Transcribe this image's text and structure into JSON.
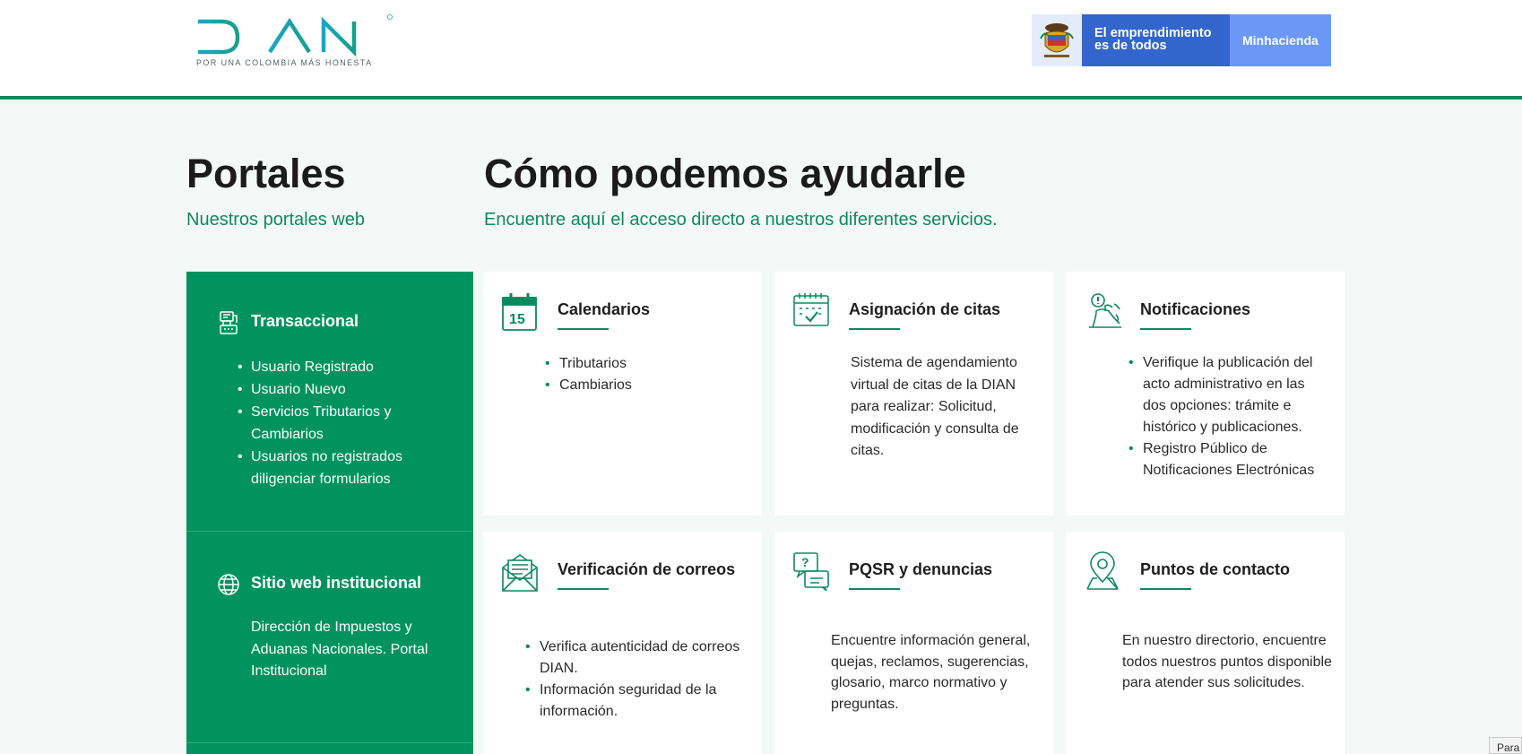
{
  "header": {
    "logo_text": "DIAN",
    "logo_tagline": "POR UNA COLOMBIA MÁS HONESTA",
    "gov_slogan_line1": "El emprendimiento",
    "gov_slogan_line2": "es de todos",
    "gov_ministry": "Minhacienda"
  },
  "portales": {
    "title": "Portales",
    "subtitle": "Nuestros portales web",
    "items": [
      {
        "title": "Transaccional",
        "bullets": [
          "Usuario Registrado",
          "Usuario Nuevo",
          "Servicios Tributarios y Cambiarios",
          "Usuarios no registrados diligenciar formularios"
        ]
      },
      {
        "title": "Sitio web institucional",
        "text": "Dirección de Impuestos y Aduanas Nacionales. Portal Institucional"
      }
    ]
  },
  "ayuda": {
    "title": "Cómo podemos ayudarle",
    "subtitle": "Encuentre aquí el acceso directo a nuestros diferentes servicios."
  },
  "cards": {
    "calendarios": {
      "title": "Calendarios",
      "icon_day": "15",
      "bullets": [
        "Tributarios",
        "Cambiarios"
      ]
    },
    "citas": {
      "title": "Asignación de citas",
      "text": "Sistema de agendamiento virtual de citas de la DIAN para realizar: Solicitud, modificación y consulta de citas."
    },
    "notificaciones": {
      "title": "Notificaciones",
      "bullets": [
        "Verifique la publicación del acto administrativo en las dos opciones: trámite e histórico y publicaciones.",
        "Registro Público de Notificaciones Electrónicas"
      ]
    },
    "correos": {
      "title": "Verificación de correos",
      "bullets": [
        "Verifica autenticidad de correos DIAN.",
        "Información seguridad de la información."
      ]
    },
    "pqsr": {
      "title": "PQSR y denuncias",
      "text": "Encuentre información general, quejas, reclamos, sugerencias, glosario, marco normativo y preguntas."
    },
    "contacto": {
      "title": "Puntos de contacto",
      "text": "En nuestro directorio, encuentre todos nuestros puntos disponible para atender sus solicitudes."
    }
  },
  "footer_tag": "Para",
  "colors": {
    "brand_green": "#00935f",
    "accent_green": "#0d8a5d",
    "gov_blue": "#3366cc",
    "gov_light_blue": "#6b98f7",
    "logo_blue": "#1a9bc9"
  }
}
